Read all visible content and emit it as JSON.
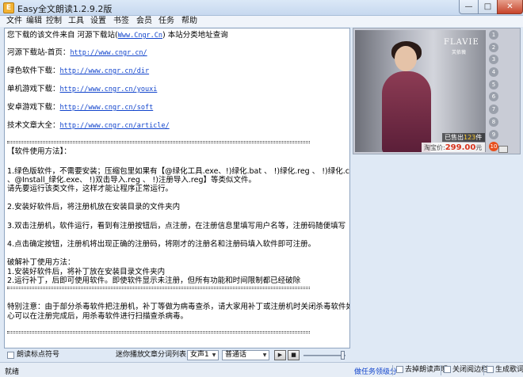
{
  "window": {
    "title": "Easy全文朗读1.2.9.2版",
    "icon": "app-logo-icon",
    "controls": {
      "minimize": "—",
      "maximize": "□",
      "close": "✕"
    }
  },
  "menu": [
    "文件",
    "编辑",
    "控制",
    "工具",
    "设置",
    "书签",
    "会员",
    "任务",
    "帮助"
  ],
  "document": {
    "intro_prefix": "您下载的该文件来自 河源下载站(",
    "intro_link": "Www.Cngr.Cn",
    "intro_suffix": ") 本站分类地址查询",
    "links": [
      {
        "label": "河源下载站-首页：",
        "url": "http://www.cngr.cn/"
      },
      {
        "label": "绿色软件下载：",
        "url": "http://www.cngr.cn/dir"
      },
      {
        "label": "单机游戏下载：",
        "url": "http://www.cngr.cn/youxi"
      },
      {
        "label": "安卓游戏下载：",
        "url": "http://www.cngr.cn/soft"
      },
      {
        "label": "技术文章大全：",
        "url": "http://www.cngr.cn/article/"
      }
    ],
    "usage_title": "【软件使用方法】：",
    "step1_line1": "1.绿色版软件，不需要安装；压缩包里如果有【@绿化工具.exe、!)绿化.bat 、 !)绿化.reg 、 !)绿化.cmd",
    "step1_line2": "、@Install_绿化.exe、 !)双击导入.reg 、 !)注册导入.reg】等类似文件。",
    "step1_line3": " 请先要运行该类文件，这样才能让程序正常运行。",
    "step2": "2.安装好软件后，将注册机放在安装目录的文件夹内",
    "step3": "3.双击注册机，软件运行，看到有注册按钮后，点注册，在注册信息里填写用户名等，注册码随便填写",
    "step4": "4.点击确定按钮，注册机将出现正确的注册码，将刚才的注册名和注册码填入软件即可注册。",
    "crack_title": "破解补丁使用方法：",
    "crack_step1": "1.安装好软件后，将补丁放在安装目录文件夹内",
    "crack_step2": "2.运行补丁，后即可使用软件。即使软件显示未注册，但所有功能和时间限制都已经破除",
    "note_line1": "特别注意：由于部分杀毒软件把注册机，补丁等做为病毒查杀，请大家用补丁或注册机时关闭杀毒软件如不放",
    "note_line2": "心可以在注册完成后，用杀毒软件进行扫描查杀病毒。"
  },
  "ad": {
    "brand": "FLAVIE",
    "brand_sub": "芙依薇",
    "sold_prefix": "已售出",
    "sold_count": "123",
    "sold_suffix": "件",
    "price_label": "淘宝价:",
    "price_value": "299.00",
    "price_suffix": "元",
    "numbers": [
      "1",
      "2",
      "3",
      "4",
      "5",
      "6",
      "7",
      "8",
      "9",
      "10"
    ],
    "active_number": "10"
  },
  "controls": {
    "read_punctuation_label": "朗读标点符号",
    "mini_play_label": "迷你播放",
    "split_list_label": "文章分词列表",
    "voice_value": "女声1",
    "speech_mode_value": "普通话"
  },
  "status": {
    "text": "就绪",
    "vip_link": "做任务领级分",
    "checkboxes": [
      "去掉朗读声明",
      "关闭阅边栏",
      "生成歌词"
    ]
  },
  "colors": {
    "link": "#1144cc",
    "accent_orange": "#e8501d",
    "price_red": "#d8331c",
    "titlebar": "#c6d8ef"
  }
}
